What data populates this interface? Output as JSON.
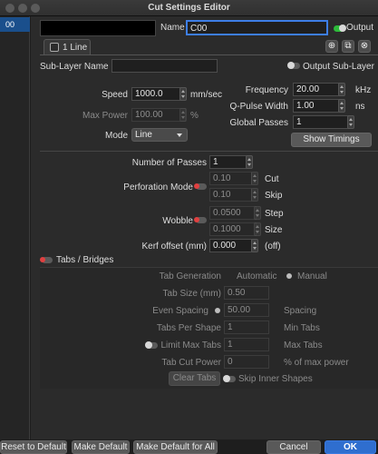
{
  "window": {
    "title": "Cut Settings Editor"
  },
  "layers": [
    "00"
  ],
  "header": {
    "name_label": "Name",
    "name_value": "C00",
    "output_label": "Output",
    "layer_name_display": ""
  },
  "tab": {
    "label": "1 Line"
  },
  "sublayer": {
    "label": "Sub-Layer Name",
    "value": "",
    "output_label": "Output Sub-Layer"
  },
  "basic": {
    "speed_label": "Speed",
    "speed_value": "1000.0",
    "speed_unit": "mm/sec",
    "maxpower_label": "Max Power",
    "maxpower_value": "100.00",
    "maxpower_unit": "%",
    "mode_label": "Mode",
    "mode_value": "Line",
    "frequency_label": "Frequency",
    "frequency_value": "20.00",
    "frequency_unit": "kHz",
    "qpulse_label": "Q-Pulse Width",
    "qpulse_value": "1.00",
    "qpulse_unit": "ns",
    "globalpasses_label": "Global Passes",
    "globalpasses_value": "1",
    "show_timings_label": "Show Timings"
  },
  "passes": {
    "numpasses_label": "Number of Passes",
    "numpasses_value": "1",
    "perforation_label": "Perforation Mode",
    "perf_cut_value": "0.10",
    "perf_cut_unit": "Cut",
    "perf_skip_value": "0.10",
    "perf_skip_unit": "Skip",
    "wobble_label": "Wobble",
    "wobble_step_value": "0.0500",
    "wobble_step_unit": "Step",
    "wobble_size_value": "0.1000",
    "wobble_size_unit": "Size",
    "kerf_label": "Kerf offset (mm)",
    "kerf_value": "0.000",
    "kerf_unit": "(off)"
  },
  "tabs_bridges": {
    "label": "Tabs / Bridges",
    "generation_label": "Tab Generation",
    "automatic_label": "Automatic",
    "manual_label": "Manual",
    "tabsize_label": "Tab Size (mm)",
    "tabsize_value": "0.50",
    "evenspacing_label": "Even Spacing",
    "spacing_value": "50.00",
    "spacing_unit": "Spacing",
    "tabspershape_label": "Tabs Per Shape",
    "tabspershape_value": "1",
    "mintabs_unit": "Min Tabs",
    "limitmax_label": "Limit Max Tabs",
    "limitmax_value": "1",
    "maxtabs_unit": "Max Tabs",
    "tabcutpower_label": "Tab Cut Power",
    "tabcutpower_value": "0",
    "tabcutpower_unit": "% of max power",
    "clear_tabs_label": "Clear Tabs",
    "skip_inner_label": "Skip Inner Shapes"
  },
  "footer": {
    "reset_label": "Reset to Default",
    "make_default_label": "Make Default",
    "make_default_all_label": "Make Default for All",
    "cancel_label": "Cancel",
    "ok_label": "OK"
  }
}
